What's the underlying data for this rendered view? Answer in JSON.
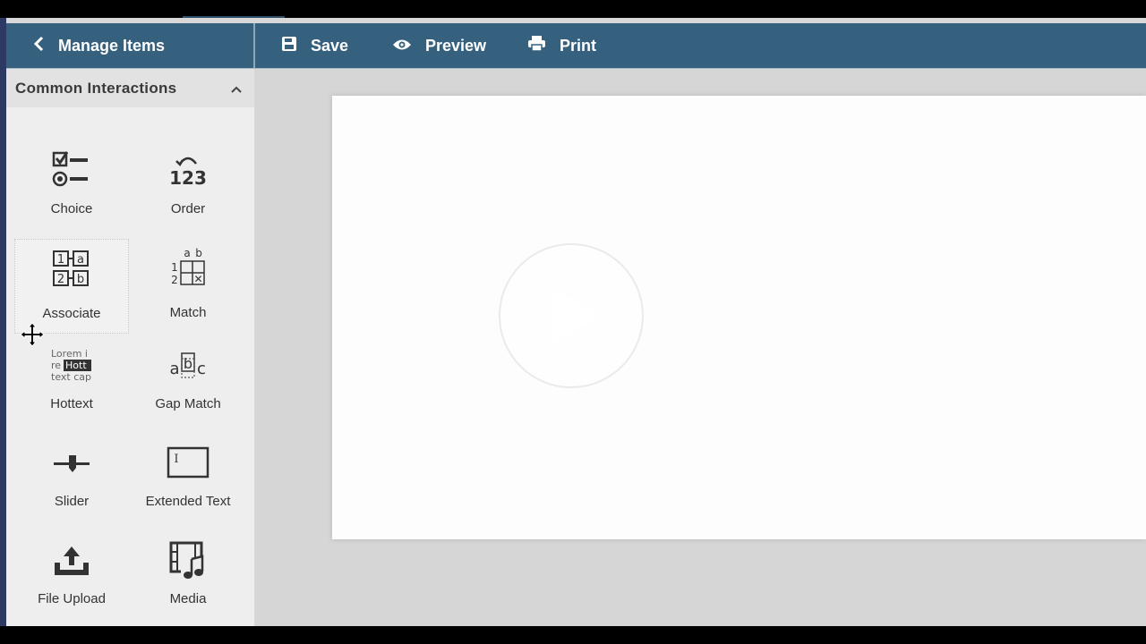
{
  "header": {
    "back_label": "Manage Items",
    "save_label": "Save",
    "preview_label": "Preview",
    "print_label": "Print"
  },
  "sidebar": {
    "section_title": "Common Interactions",
    "items": [
      {
        "label": "Choice",
        "icon": "choice-icon"
      },
      {
        "label": "Order",
        "icon": "order-icon"
      },
      {
        "label": "Associate",
        "icon": "associate-icon"
      },
      {
        "label": "Match",
        "icon": "match-icon"
      },
      {
        "label": "Hottext",
        "icon": "hottext-icon"
      },
      {
        "label": "Gap Match",
        "icon": "gap-match-icon"
      },
      {
        "label": "Slider",
        "icon": "slider-icon"
      },
      {
        "label": "Extended Text",
        "icon": "extended-text-icon"
      },
      {
        "label": "File Upload",
        "icon": "file-upload-icon"
      },
      {
        "label": "Media",
        "icon": "media-icon"
      }
    ],
    "icon_text": {
      "order_digits": "123",
      "associate": [
        "1",
        "a",
        "2",
        "b"
      ],
      "match": [
        "a",
        "b",
        "1",
        "2",
        "✕"
      ],
      "hottext_lines": [
        "Lorem i",
        "re",
        "Hott",
        "text cap"
      ],
      "gap_match": [
        "a",
        "b",
        "c"
      ],
      "extended_text_cursor": "I"
    }
  },
  "colors": {
    "header_bg": "#36617e",
    "sidebar_bg": "#eeeeee",
    "canvas_bg": "#d6d6d6",
    "paper_bg": "#fdfdfd",
    "icon_color": "#333333"
  }
}
